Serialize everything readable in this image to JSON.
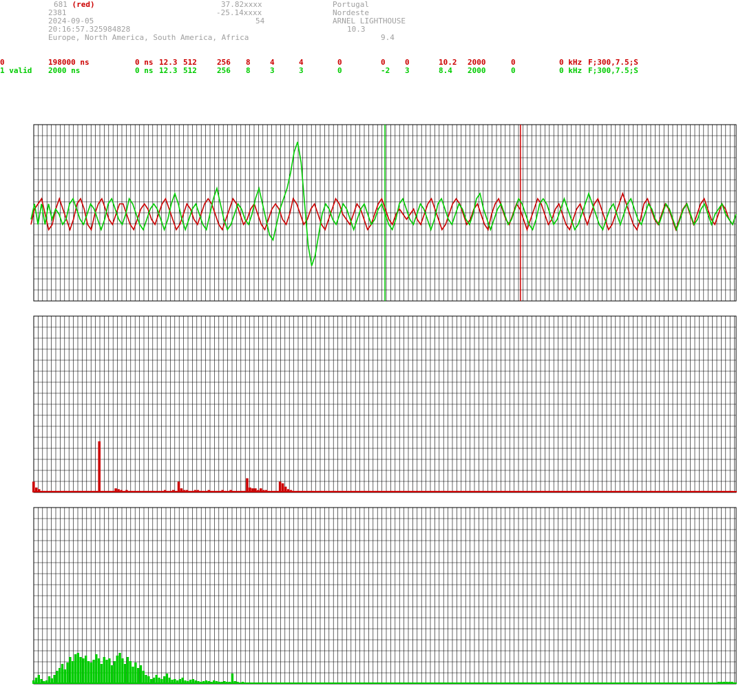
{
  "header": {
    "station_id": "681",
    "station_tag": "(red)",
    "count": "2381",
    "date": "2024-09-05",
    "time": "20:16:57.325984828",
    "regions": "Europe, North America, South America, Africa",
    "lat": "37.82xxxx",
    "lon": "-25.14xxxx",
    "alt": "54",
    "country": "Portugal",
    "place": "Nordeste",
    "site": "ARNEL LIGHTHOUSE",
    "val_a": "10.3",
    "val_b": "9.4"
  },
  "rows": [
    {
      "color": "#cc0000",
      "cells": [
        "0",
        "198000 ns",
        "0 ns",
        "12.3",
        "512",
        "256",
        "8",
        "4",
        "4",
        "0",
        "0",
        "0",
        "10.2",
        "2000",
        "0",
        "0 kHz",
        "F;300,7.5;S"
      ]
    },
    {
      "color": "#00cc00",
      "cells": [
        "1 valid",
        "2000 ns",
        "0 ns",
        "12.3",
        "512",
        "256",
        "8",
        "3",
        "3",
        "0",
        "-2",
        "3",
        "8.4",
        "2000",
        "0",
        "0 kHz",
        "F;300,7.5;S"
      ]
    }
  ],
  "colors": {
    "red": "#cc0000",
    "green": "#00cc00",
    "grid": "#000000",
    "label": "#a0a0a0"
  },
  "chart_data": [
    {
      "type": "line",
      "title": "",
      "grid": true,
      "markers": {
        "green_x_frac": 0.5,
        "red_x_frac": 0.693
      },
      "series": [
        {
          "color": "#cc0000",
          "values": [
            -2,
            1,
            2,
            3,
            0,
            -3,
            -2,
            1,
            3,
            1,
            -1,
            -3,
            -1,
            2,
            3,
            1,
            -2,
            -3,
            0,
            2,
            3,
            1,
            -1,
            -2,
            0,
            2,
            2,
            0,
            -2,
            -3,
            -1,
            1,
            2,
            1,
            -1,
            -2,
            0,
            2,
            3,
            1,
            -1,
            -3,
            -2,
            0,
            2,
            1,
            -1,
            -2,
            0,
            2,
            3,
            2,
            0,
            -2,
            -3,
            -1,
            1,
            3,
            2,
            0,
            -2,
            -1,
            1,
            2,
            0,
            -2,
            -3,
            -1,
            1,
            2,
            1,
            -1,
            -2,
            0,
            3,
            2,
            0,
            -2,
            -1,
            1,
            2,
            0,
            -2,
            -3,
            -1,
            1,
            3,
            2,
            0,
            -1,
            -2,
            0,
            2,
            1,
            -1,
            -3,
            -2,
            0,
            2,
            3,
            1,
            -1,
            -2,
            0,
            1,
            0,
            -1,
            0,
            1,
            -1,
            -2,
            0,
            2,
            3,
            1,
            -1,
            -3,
            -2,
            0,
            2,
            3,
            2,
            0,
            -2,
            -1,
            1,
            2,
            0,
            -2,
            -3,
            0,
            2,
            3,
            1,
            -1,
            -2,
            0,
            2,
            1,
            -1,
            -3,
            -1,
            1,
            3,
            2,
            0,
            -2,
            -1,
            1,
            2,
            0,
            -2,
            -3,
            -1,
            1,
            2,
            0,
            -2,
            0,
            2,
            3,
            1,
            -1,
            -3,
            -2,
            0,
            2,
            4,
            2,
            0,
            -2,
            -3,
            -1,
            2,
            3,
            1,
            -1,
            -2,
            0,
            2,
            1,
            -1,
            -3,
            -1,
            1,
            2,
            0,
            -2,
            0,
            2,
            3,
            1,
            -1,
            -2,
            0,
            2,
            1,
            -1,
            -2,
            0
          ]
        },
        {
          "color": "#00cc00",
          "values": [
            -1,
            2,
            -2,
            2,
            -2,
            2,
            -1,
            1,
            0,
            -2,
            -1,
            2,
            3,
            1,
            -1,
            -2,
            0,
            2,
            1,
            -1,
            -3,
            -1,
            2,
            3,
            1,
            -1,
            -2,
            0,
            3,
            2,
            0,
            -2,
            -3,
            -1,
            1,
            2,
            1,
            -1,
            -3,
            -1,
            2,
            4,
            2,
            -1,
            -3,
            -1,
            1,
            2,
            0,
            -2,
            -3,
            0,
            3,
            5,
            2,
            -1,
            -3,
            -2,
            0,
            2,
            1,
            -1,
            -2,
            0,
            3,
            5,
            2,
            -1,
            -4,
            -5,
            -2,
            1,
            3,
            5,
            8,
            12,
            14,
            10,
            2,
            -6,
            -10,
            -8,
            -4,
            0,
            2,
            1,
            -1,
            -2,
            0,
            2,
            1,
            -1,
            -3,
            -1,
            1,
            2,
            0,
            -2,
            -1,
            1,
            2,
            0,
            -2,
            -3,
            -1,
            2,
            3,
            1,
            -1,
            -2,
            0,
            2,
            1,
            -1,
            -3,
            -1,
            2,
            3,
            1,
            -1,
            -2,
            0,
            2,
            1,
            -1,
            -2,
            0,
            3,
            4,
            1,
            -1,
            -3,
            -1,
            1,
            2,
            0,
            -2,
            -1,
            1,
            3,
            2,
            0,
            -2,
            -3,
            -1,
            2,
            3,
            2,
            0,
            -2,
            -1,
            1,
            3,
            1,
            -1,
            -3,
            -2,
            0,
            2,
            4,
            2,
            0,
            -2,
            -3,
            -1,
            1,
            2,
            0,
            -2,
            0,
            2,
            3,
            1,
            -1,
            -2,
            0,
            2,
            1,
            -1,
            -2,
            0,
            2,
            1,
            -1,
            -3,
            -1,
            1,
            2,
            0,
            -2,
            -1,
            1,
            2,
            0,
            -2,
            0,
            1,
            2,
            0,
            -1,
            -2,
            0
          ]
        }
      ]
    },
    {
      "type": "bar",
      "title": "",
      "grid": true,
      "series": [
        {
          "color": "#cc0000",
          "values": [
            12,
            5,
            3,
            1,
            1,
            1,
            1,
            1,
            1,
            1,
            1,
            1,
            1,
            1,
            1,
            1,
            1,
            1,
            1,
            1,
            1,
            1,
            1,
            1,
            60,
            1,
            1,
            1,
            1,
            1,
            4,
            3,
            2,
            1,
            2,
            1,
            1,
            1,
            1,
            1,
            1,
            1,
            1,
            1,
            1,
            1,
            1,
            1,
            2,
            1,
            1,
            2,
            1,
            12,
            4,
            2,
            2,
            1,
            1,
            2,
            2,
            1,
            1,
            1,
            2,
            1,
            1,
            1,
            1,
            2,
            1,
            1,
            2,
            1,
            1,
            1,
            1,
            1,
            16,
            5,
            4,
            4,
            2,
            4,
            2,
            2,
            1,
            1,
            1,
            1,
            12,
            10,
            6,
            3,
            2,
            1,
            1,
            1,
            1,
            1,
            1,
            1,
            1,
            1,
            1,
            1,
            1,
            1,
            1,
            1,
            1,
            1,
            1,
            1,
            1,
            1,
            1,
            1,
            1,
            1,
            1,
            1,
            1,
            1,
            1,
            1,
            1,
            1,
            1,
            1,
            1,
            1,
            1,
            1,
            1,
            1,
            1,
            1,
            1,
            1,
            1,
            1,
            1,
            1,
            1,
            1,
            1,
            1,
            1,
            1,
            1,
            1,
            1,
            1,
            1,
            1,
            1,
            1,
            1,
            1,
            1,
            1,
            1,
            1,
            1,
            1,
            1,
            1,
            1,
            1,
            1,
            1,
            1,
            1,
            1,
            1,
            1,
            1,
            1,
            1,
            1,
            1,
            1,
            1,
            1,
            1,
            1,
            1,
            1,
            1,
            1,
            1,
            1,
            1,
            1,
            1,
            1,
            1,
            1,
            1,
            1,
            1,
            1,
            1,
            1,
            1,
            1,
            1,
            1,
            1,
            1,
            1,
            1,
            1,
            1,
            1,
            1,
            1,
            1,
            1,
            1,
            1,
            1,
            1,
            1,
            1,
            1,
            1,
            1,
            1,
            1,
            1,
            1,
            1,
            1,
            1,
            1,
            1,
            1,
            1,
            1,
            1,
            1,
            1,
            1,
            1,
            1,
            1,
            1,
            1,
            1,
            1,
            1,
            1,
            1,
            1
          ]
        }
      ]
    },
    {
      "type": "bar",
      "title": "",
      "grid": true,
      "series": [
        {
          "color": "#00cc00",
          "values": [
            4,
            8,
            12,
            6,
            3,
            4,
            10,
            7,
            12,
            18,
            22,
            28,
            20,
            30,
            38,
            32,
            42,
            44,
            38,
            36,
            40,
            32,
            30,
            34,
            42,
            36,
            28,
            38,
            34,
            36,
            26,
            32,
            40,
            44,
            36,
            28,
            38,
            32,
            24,
            30,
            22,
            26,
            18,
            12,
            10,
            6,
            8,
            12,
            8,
            6,
            10,
            14,
            8,
            5,
            6,
            4,
            6,
            8,
            4,
            3,
            5,
            6,
            4,
            3,
            2,
            3,
            4,
            3,
            2,
            4,
            3,
            2,
            2,
            3,
            2,
            2,
            14,
            3,
            2,
            1,
            2,
            1,
            1,
            1,
            1,
            1,
            1,
            1,
            1,
            1,
            1,
            1,
            1,
            1,
            1,
            1,
            1,
            1,
            1,
            1,
            1,
            1,
            1,
            1,
            1,
            1,
            1,
            1,
            1,
            1,
            1,
            1,
            1,
            1,
            1,
            1,
            1,
            1,
            1,
            1,
            1,
            1,
            1,
            1,
            1,
            1,
            1,
            1,
            1,
            1,
            1,
            1,
            1,
            1,
            1,
            1,
            1,
            1,
            1,
            1,
            1,
            1,
            1,
            1,
            1,
            1,
            1,
            1,
            1,
            1,
            1,
            1,
            1,
            1,
            1,
            1,
            1,
            1,
            1,
            1,
            1,
            1,
            1,
            1,
            1,
            1,
            1,
            1,
            1,
            1,
            1,
            1,
            1,
            1,
            1,
            1,
            1,
            1,
            1,
            1,
            1,
            1,
            1,
            1,
            1,
            1,
            1,
            1,
            1,
            1,
            1,
            1,
            1,
            1,
            1,
            1,
            1,
            1,
            1,
            1,
            1,
            1,
            1,
            1,
            1,
            1,
            1,
            1,
            1,
            1,
            1,
            1,
            1,
            1,
            1,
            1,
            1,
            1,
            1,
            1,
            1,
            1,
            1,
            1,
            1,
            1,
            1,
            1,
            1,
            1,
            1,
            1,
            1,
            1,
            1,
            1,
            1,
            1,
            1,
            1,
            1,
            1,
            1,
            1,
            1,
            1,
            1,
            1,
            1,
            1,
            1,
            1,
            1,
            1,
            1,
            1,
            1,
            1,
            1,
            1,
            1,
            1,
            2,
            2,
            2,
            2,
            2,
            2
          ]
        }
      ]
    }
  ]
}
